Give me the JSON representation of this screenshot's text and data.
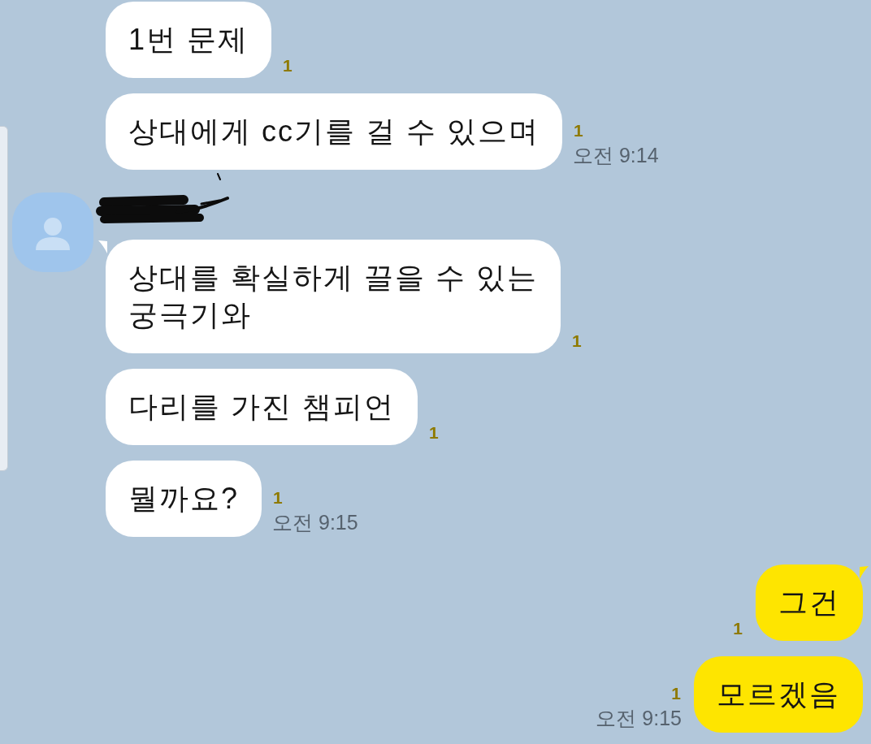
{
  "chat": {
    "messages": [
      {
        "kind": "received",
        "text": "1번 문제",
        "unread": "1",
        "tail": false
      },
      {
        "kind": "received",
        "text": "상대에게 cc기를 걸 수 있으며",
        "unread": "1",
        "time": "오전 9:14",
        "tail": false
      },
      {
        "kind": "received",
        "text": "상대를 확실하게 끌을 수 있는\n궁극기와",
        "unread": "1",
        "tail": true,
        "avatar": true,
        "name_scribbled": true
      },
      {
        "kind": "received",
        "text": "다리를 가진 챔피언",
        "unread": "1",
        "tail": false
      },
      {
        "kind": "received",
        "text": "뭘까요?",
        "unread": "1",
        "time": "오전 9:15",
        "tail": false
      },
      {
        "kind": "sent",
        "text": "그건",
        "unread": "1",
        "tail": true
      },
      {
        "kind": "sent",
        "text": "모르겠음",
        "unread": "1",
        "time": "오전 9:15",
        "tail": false
      }
    ]
  }
}
